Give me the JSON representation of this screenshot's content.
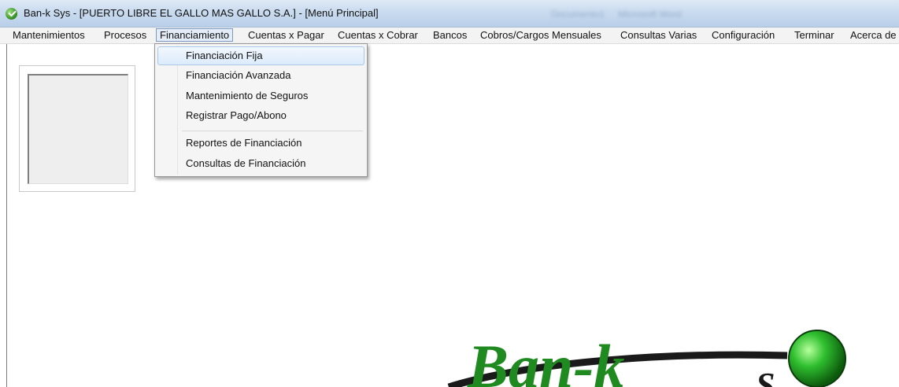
{
  "window": {
    "title": "Ban-k Sys - [PUERTO LIBRE EL GALLO MAS GALLO S.A.] - [Menú Principal]",
    "faded_tabs": [
      "Documento1",
      "Microsoft Word"
    ]
  },
  "menubar": {
    "items": [
      {
        "label": "Mantenimientos"
      },
      {
        "label": "Procesos"
      },
      {
        "label": "Financiamiento"
      },
      {
        "label": "Cuentas x Pagar"
      },
      {
        "label": "Cuentas x Cobrar"
      },
      {
        "label": "Bancos"
      },
      {
        "label": "Cobros/Cargos Mensuales"
      },
      {
        "label": "Consultas Varias"
      },
      {
        "label": "Configuración"
      },
      {
        "label": "Terminar"
      },
      {
        "label": "Acerca de"
      }
    ]
  },
  "dropdown": {
    "items": [
      {
        "label": "Financiación Fija"
      },
      {
        "label": "Financiación Avanzada"
      },
      {
        "label": "Mantenimiento de Seguros"
      },
      {
        "label": "Registrar Pago/Abono"
      },
      {
        "label": "Reportes de Financiación"
      },
      {
        "label": "Consultas de Financiación"
      }
    ]
  },
  "logo": {
    "text": "Ban-k",
    "text_tail": "S",
    "text_color": "#1f8a1f",
    "ball_color": "#2fbf2f"
  }
}
